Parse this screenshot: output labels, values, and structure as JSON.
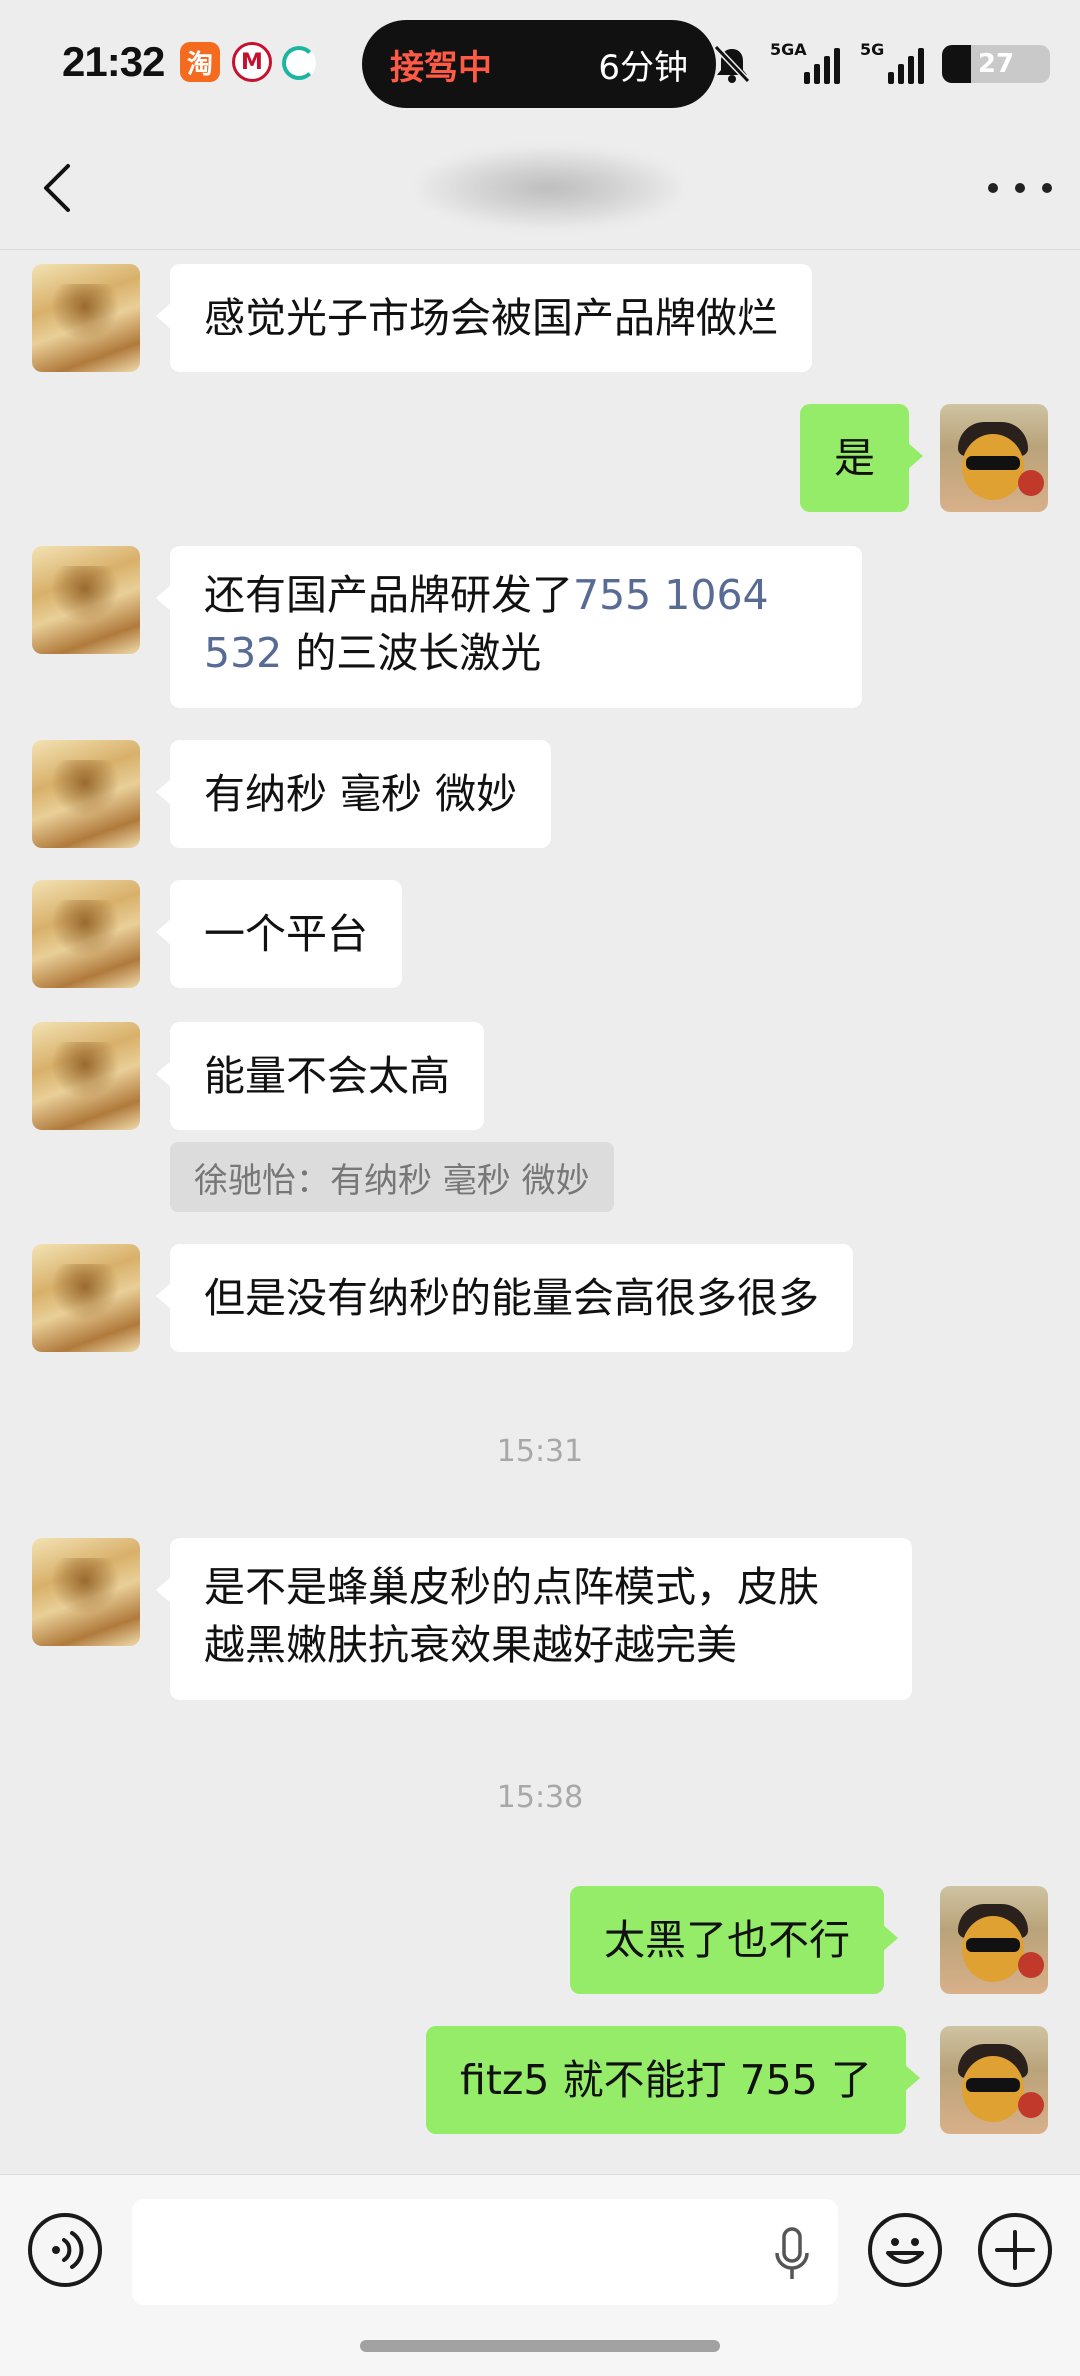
{
  "status_bar": {
    "time": "21:32",
    "app_icons": [
      "taobao-icon",
      "metro-icon",
      "refresh-app-icon"
    ],
    "island_left": "接驾中",
    "island_right": "6分钟",
    "sim1_label": "5GA",
    "sim2_label": "5G",
    "battery": "27",
    "battery_level": 0.27
  },
  "nav": {
    "back_icon": "chevron-left-icon",
    "more_icon": "more-icon"
  },
  "messages": [
    {
      "side": "in",
      "text": "感觉光子市场会被国产品牌做烂"
    },
    {
      "side": "out",
      "text": "是"
    },
    {
      "side": "in",
      "parts": [
        "还有国产品牌研发了",
        "755 1064",
        "532",
        "的三波长激光"
      ]
    },
    {
      "side": "in",
      "text": "有纳秒 毫秒 微妙"
    },
    {
      "side": "in",
      "text": "一个平台"
    },
    {
      "side": "in",
      "text": "能量不会太高",
      "quote": "徐驰怡：有纳秒 毫秒 微妙"
    },
    {
      "side": "in",
      "text": "但是没有纳秒的能量会高很多很多"
    },
    {
      "type": "time",
      "text": "15:31"
    },
    {
      "side": "in",
      "lines": [
        "是不是蜂巢皮秒的点阵模式，皮肤",
        "越黑嫩肤抗衰效果越好越完美"
      ]
    },
    {
      "type": "time",
      "text": "15:38"
    },
    {
      "side": "out",
      "text": "太黑了也不行"
    },
    {
      "side": "out",
      "text": "fitz5 就不能打 755 了"
    }
  ],
  "input_bar": {
    "voice_icon": "voice-icon",
    "input_value": "",
    "mic_icon": "mic-icon",
    "emoji_icon": "emoji-icon",
    "plus_icon": "plus-icon"
  }
}
